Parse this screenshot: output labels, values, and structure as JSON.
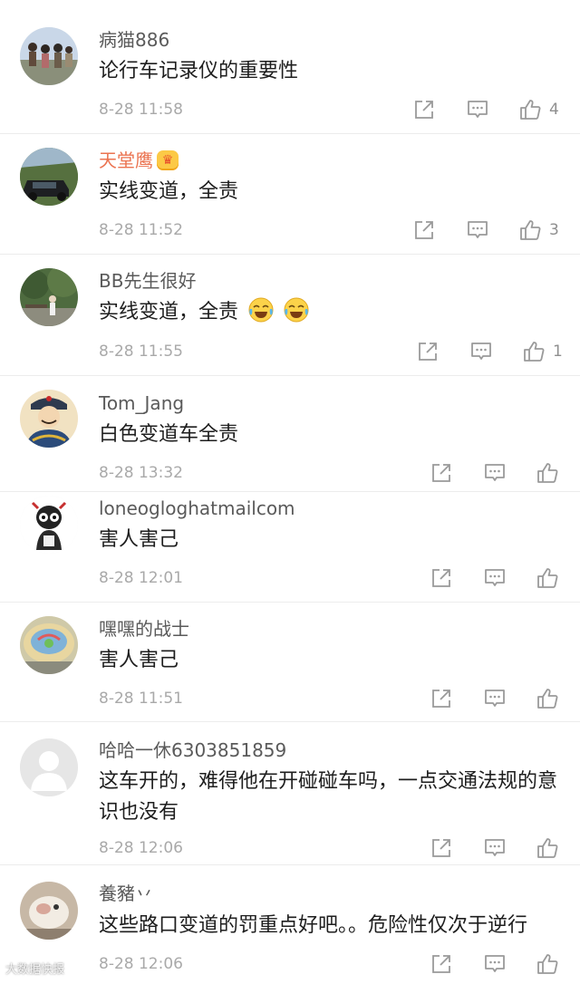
{
  "colors": {
    "username": "#5a5a5a",
    "vip_username": "#eb7350",
    "text": "#1e1e1e",
    "time": "#a9a9a9",
    "icon": "#9a9a9a"
  },
  "comments": [
    {
      "username": "病猫886",
      "text": "论行车记录仪的重要性",
      "time": "8-28 11:58",
      "likes": "4"
    },
    {
      "username": "天堂鹰",
      "vip": true,
      "vip_badge_icon": "crown-vip-icon",
      "text": "实线变道，全责",
      "time": "8-28 11:52",
      "likes": "3"
    },
    {
      "username": "BB先生很好",
      "text": "实线变道，全责",
      "text_emojis": [
        "laughing-tears-emoji",
        "laughing-tears-emoji"
      ],
      "time": "8-28 11:55",
      "likes": "1"
    },
    {
      "username": "Tom_Jang",
      "text": "白色变道车全责",
      "time": "8-28 13:32",
      "likes": ""
    },
    {
      "username": "loneogloghatmailcom",
      "text": "害人害己",
      "time": "8-28 12:01",
      "likes": ""
    },
    {
      "username": "嘿嘿的战士",
      "text": "害人害己",
      "time": "8-28 11:51",
      "likes": ""
    },
    {
      "username": "哈哈一休6303851859",
      "text": "这车开的，难得他在开碰碰车吗，一点交通法规的意识也没有",
      "time": "8-28 12:06",
      "likes": ""
    },
    {
      "username": "養豬丷",
      "text": "这些路口变道的罚重点好吧。。危险性仅次于逆行",
      "time": "8-28 12:06",
      "likes": ""
    }
  ],
  "action_icons": [
    "forward-icon",
    "comment-icon",
    "like-icon"
  ],
  "watermark": "大数据快报"
}
